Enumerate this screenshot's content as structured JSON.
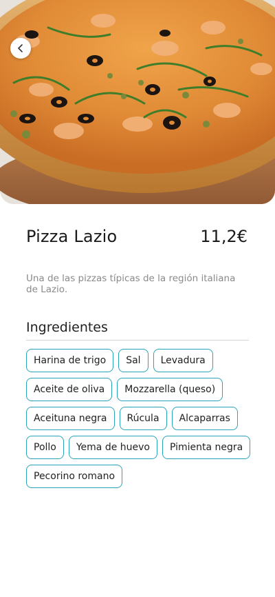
{
  "product": {
    "name": "Pizza Lazio",
    "price": "11,2€",
    "description": "Una de las pizzas típicas de la región italiana de Lazio."
  },
  "ingredients": {
    "title": "Ingredientes",
    "items": [
      "Harina de trigo",
      "Sal",
      "Levadura",
      "Aceite de oliva",
      "Mozzarella (queso)",
      "Aceituna negra",
      "Rúcula",
      "Alcaparras",
      "Pollo",
      "Yema de huevo",
      "Pimienta negra",
      "Pecorino romano"
    ]
  },
  "icons": {
    "back": "chevron-left-icon"
  },
  "colors": {
    "accent": "#27a4b9",
    "text": "#1a1a1a",
    "muted": "#8a8a8a"
  }
}
